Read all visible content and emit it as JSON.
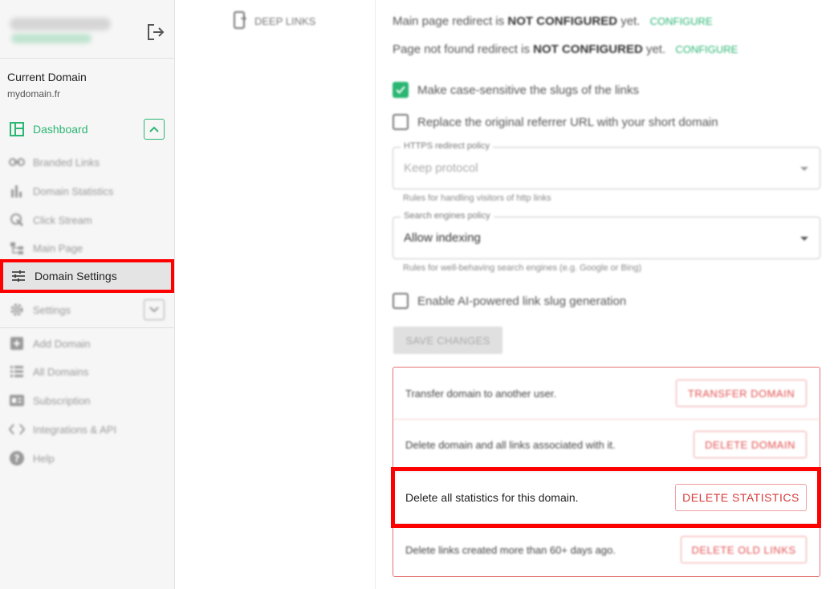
{
  "sidebar": {
    "current_domain_label": "Current Domain",
    "current_domain_value": "mydomain.fr",
    "items": [
      {
        "label": "Dashboard"
      },
      {
        "label": "Branded Links"
      },
      {
        "label": "Domain Statistics"
      },
      {
        "label": "Click Stream"
      },
      {
        "label": "Main Page"
      },
      {
        "label": "Domain Settings"
      },
      {
        "label": "Settings"
      },
      {
        "label": "Add Domain"
      },
      {
        "label": "All Domains"
      },
      {
        "label": "Subscription"
      },
      {
        "label": "Integrations & API"
      },
      {
        "label": "Help"
      }
    ],
    "accent_color": "#2bb673"
  },
  "tabs": {
    "deep_links": "DEEP LINKS"
  },
  "settings": {
    "main_redirect_prefix": "Main page redirect is",
    "main_redirect_status": "NOT CONFIGURED",
    "main_redirect_suffix": "yet.",
    "notfound_redirect_prefix": "Page not found redirect is",
    "notfound_redirect_status": "NOT CONFIGURED",
    "notfound_redirect_suffix": "yet.",
    "configure": "CONFIGURE",
    "case_sensitive": {
      "label": "Make case-sensitive the slugs of the links",
      "checked": true
    },
    "replace_referrer": {
      "label": "Replace the original referrer URL with your short domain",
      "checked": false
    },
    "https_policy": {
      "legend": "HTTPS redirect policy",
      "value": "Keep protocol",
      "hint": "Rules for handling visitors of http links"
    },
    "search_policy": {
      "legend": "Search engines policy",
      "value": "Allow indexing",
      "hint": "Rules for well-behaving search engines (e.g. Google or Bing)"
    },
    "ai_slug": {
      "label": "Enable AI-powered link slug generation",
      "checked": false
    },
    "save_button": "SAVE CHANGES"
  },
  "danger_zone": {
    "transfer": {
      "text": "Transfer domain to another user.",
      "button": "TRANSFER DOMAIN"
    },
    "delete_domain": {
      "text": "Delete domain and all links associated with it.",
      "button": "DELETE DOMAIN"
    },
    "delete_stats": {
      "text": "Delete all statistics for this domain.",
      "button": "DELETE STATISTICS"
    },
    "delete_old": {
      "text": "Delete links created more than 60+ days ago.",
      "button": "DELETE OLD LINKS"
    },
    "danger_color": "#e35252"
  },
  "highlight_color": "#ff0000"
}
